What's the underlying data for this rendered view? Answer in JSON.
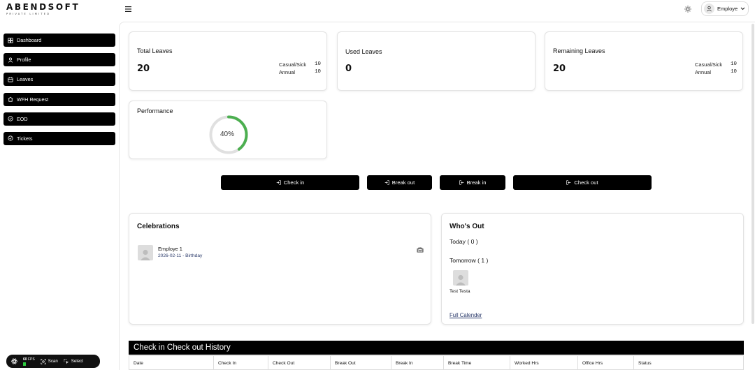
{
  "brand": {
    "name": "ABENDSOFT",
    "tagline": "PRIVATE LIMITED"
  },
  "header": {
    "user_name": "Employe",
    "icons": [
      "menu-icon",
      "sun-icon",
      "user-icon",
      "chevron-down-icon"
    ]
  },
  "sidebar": {
    "items": [
      {
        "label": "Dashboard",
        "icon": "dashboard-icon"
      },
      {
        "label": "Profile",
        "icon": "user-icon"
      },
      {
        "label": "Leaves",
        "icon": "calendar-icon"
      },
      {
        "label": "WFH Request",
        "icon": "home-icon"
      },
      {
        "label": "EOD",
        "icon": "check-circle-icon"
      },
      {
        "label": "Tickets",
        "icon": "check-circle-icon"
      }
    ]
  },
  "stats": {
    "total": {
      "title": "Total Leaves",
      "value": "20",
      "breakdown": [
        {
          "label": "Casual/Sick",
          "value": "10"
        },
        {
          "label": "Annual",
          "value": "10"
        }
      ]
    },
    "used": {
      "title": "Used Leaves",
      "value": "0"
    },
    "remaining": {
      "title": "Remaining Leaves",
      "value": "20",
      "breakdown": [
        {
          "label": "Casual/Sick",
          "value": "10"
        },
        {
          "label": "Annual",
          "value": "10"
        }
      ]
    }
  },
  "performance": {
    "title": "Performance",
    "percent": 40,
    "label": "40%",
    "color": "#4caf50"
  },
  "actions": {
    "check_in": "Check in",
    "break_out": "Break out",
    "break_in": "Break in",
    "check_out": "Check out"
  },
  "celebrations": {
    "title": "Celebrations",
    "items": [
      {
        "name": "Employe 1",
        "detail": "2026-02-11 - Birthday",
        "icon": "cake-icon"
      }
    ]
  },
  "whos_out": {
    "title": "Who's Out",
    "today": "Today ( 0 )",
    "tomorrow": "Tomorrow ( 1 )",
    "tomorrow_people": [
      {
        "name": "Test Testa"
      }
    ],
    "full_calendar": "Full Calender"
  },
  "history": {
    "title": "Check in Check out History",
    "columns": [
      "Date",
      "Check In",
      "Check Out",
      "Break Out",
      "Break In",
      "Break Time",
      "Worked Hrs",
      "Office Hrs",
      "Status"
    ]
  },
  "devtool": {
    "fps": "60",
    "fps_unit": "FPS",
    "scan": "Scan",
    "select": "Select"
  }
}
